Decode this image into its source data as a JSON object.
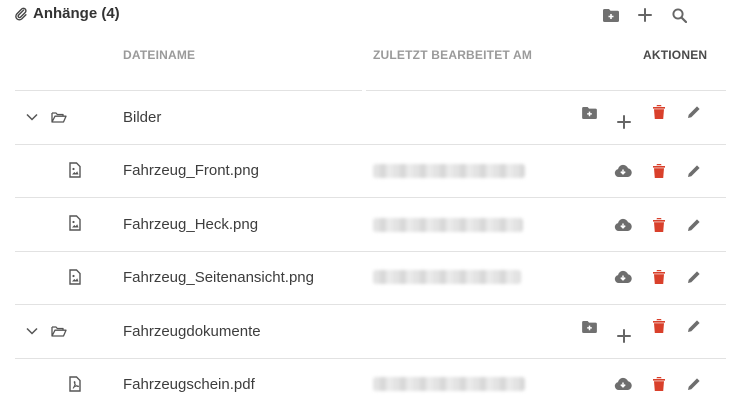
{
  "panel": {
    "title": "Anhänge (4)",
    "icons": [
      "paperclip-icon",
      "new-folder-icon",
      "plus-icon",
      "search-icon"
    ]
  },
  "columns": {
    "name": "DATEINAME",
    "date": "ZULETZT BEARBEITET AM",
    "actions": "AKTIONEN"
  },
  "rows": [
    {
      "type": "folder",
      "name": "Bilder",
      "date": "",
      "actions": [
        "new-folder-icon",
        "plus-icon",
        "trash-icon",
        "pencil-icon"
      ]
    },
    {
      "type": "file",
      "name": "Fahrzeug_Front.png",
      "date": "",
      "actions": [
        "download-icon",
        "trash-icon",
        "pencil-icon"
      ]
    },
    {
      "type": "file",
      "name": "Fahrzeug_Heck.png",
      "date": "",
      "actions": [
        "download-icon",
        "trash-icon",
        "pencil-icon"
      ]
    },
    {
      "type": "file",
      "name": "Fahrzeug_Seitenansicht.png",
      "date": "",
      "actions": [
        "download-icon",
        "trash-icon",
        "pencil-icon"
      ]
    },
    {
      "type": "folder",
      "name": "Fahrzeugdokumente",
      "date": "",
      "actions": [
        "new-folder-icon",
        "plus-icon",
        "trash-icon",
        "pencil-icon"
      ]
    },
    {
      "type": "file",
      "name": "Fahrzeugschein.pdf",
      "date": "",
      "actions": [
        "download-icon",
        "trash-icon",
        "pencil-icon"
      ]
    }
  ],
  "colors": {
    "accent_delete": "#d9402b",
    "icon_gray": "#6e6e6e",
    "header_gray": "#9a9a9a",
    "divider": "#e2e2e2"
  }
}
